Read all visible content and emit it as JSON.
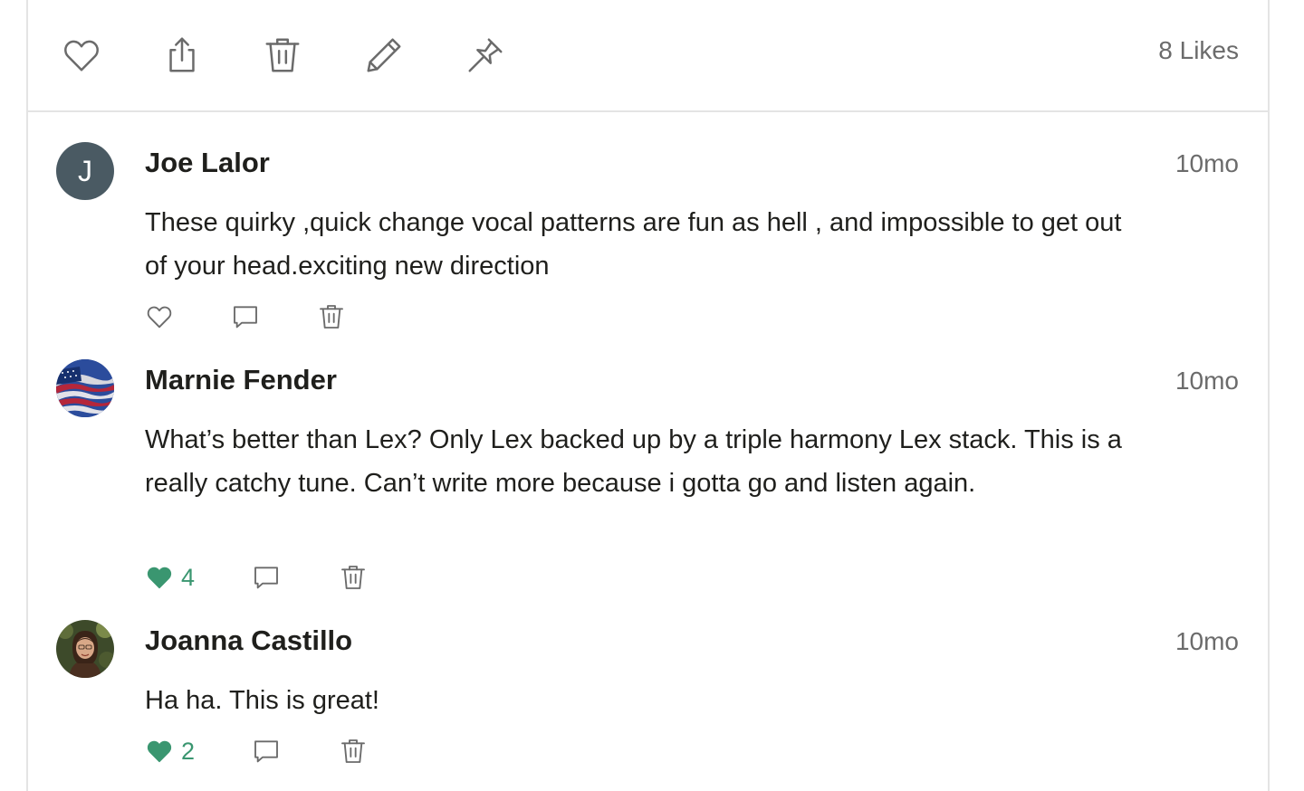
{
  "post": {
    "likes_label": "8 Likes",
    "toolbar_icons": [
      "heart-icon",
      "share-icon",
      "trash-icon",
      "pencil-icon",
      "pin-icon"
    ]
  },
  "comments": [
    {
      "avatar_initial": "J",
      "avatar_color": "#4a5a63",
      "author": "Joe Lalor",
      "time": "10mo",
      "text": "These quirky ,quick change vocal patterns are fun as hell , and impossible to get out of your head.exciting new direction",
      "liked": false,
      "like_count": ""
    },
    {
      "avatar_initial": "",
      "author": "Marnie Fender",
      "time": "10mo",
      "text": "What’s better than Lex?  Only Lex backed up by a triple harmony Lex stack.  This is a really catchy tune.  Can’t write more because i gotta go and listen again.",
      "liked": true,
      "like_count": "4"
    },
    {
      "avatar_initial": "",
      "author": "Joanna Castillo",
      "time": "10mo",
      "text": "Ha ha. This is great!",
      "liked": true,
      "like_count": "2"
    }
  ],
  "colors": {
    "liked_green": "#3a9670",
    "muted_text": "#6b6b6b",
    "icon_gray": "#6b6b6b"
  }
}
